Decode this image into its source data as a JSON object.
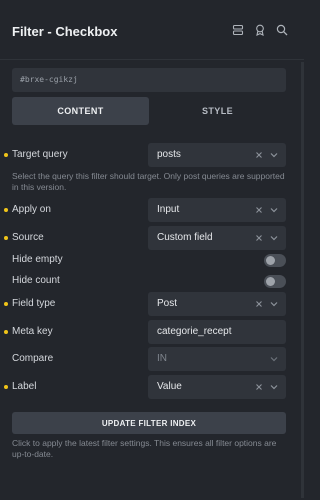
{
  "header": {
    "title": "Filter - Checkbox"
  },
  "element_id": "#brxe-cgikzj",
  "tabs": [
    {
      "label": "CONTENT",
      "active": true
    },
    {
      "label": "STYLE",
      "active": false
    }
  ],
  "fields": {
    "target_query": {
      "label": "Target query",
      "value": "posts"
    },
    "target_query_desc": "Select the query this filter should target. Only post queries are supported in this version.",
    "apply_on": {
      "label": "Apply on",
      "value": "Input"
    },
    "source": {
      "label": "Source",
      "value": "Custom field"
    },
    "hide_empty": {
      "label": "Hide empty",
      "on": false
    },
    "hide_count": {
      "label": "Hide count",
      "on": false
    },
    "field_type": {
      "label": "Field type",
      "value": "Post"
    },
    "meta_key": {
      "label": "Meta key",
      "value": "categorie_recept"
    },
    "compare": {
      "label": "Compare",
      "placeholder": "IN"
    },
    "label": {
      "label": "Label",
      "value": "Value"
    }
  },
  "update_button": "UPDATE FILTER INDEX",
  "update_desc": "Click to apply the latest filter settings. This ensures all filter options are up-to-date.",
  "colors": {
    "accent": "#f0c419",
    "panel": "#23262c",
    "field": "#30343b"
  }
}
